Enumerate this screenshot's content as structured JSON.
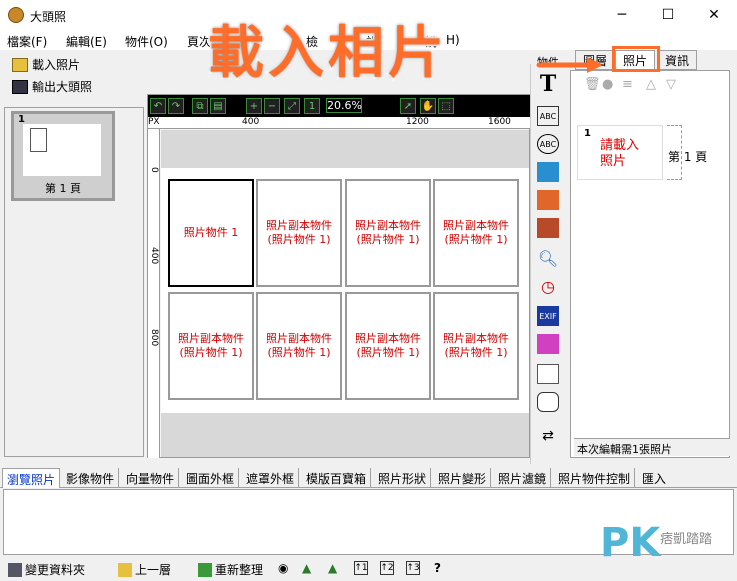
{
  "window": {
    "title": "大頭照",
    "min": "─",
    "max": "☐",
    "close": "✕"
  },
  "menu": [
    "檔案(F)",
    "編輯(E)",
    "物件(O)",
    "頁次",
    "檢",
    "設",
    "說",
    "H)"
  ],
  "left_toolbar": {
    "load_photo": "載入照片",
    "export": "輸出大頭照"
  },
  "thumbnail": {
    "num": "1",
    "label": "第 1 頁"
  },
  "editor_toolbar": {
    "zoom": "20.6%"
  },
  "ruler": {
    "h": [
      "PX",
      "400",
      "1200",
      "1600"
    ],
    "v": [
      "0",
      "400",
      "800"
    ]
  },
  "cells": [
    "照片物件 1",
    "照片副本物件\n(照片物件 1)",
    "照片副本物件\n(照片物件 1)",
    "照片副本物件\n(照片物件 1)",
    "照片副本物件\n(照片物件 1)",
    "照片副本物件\n(照片物件 1)",
    "照片副本物件\n(照片物件 1)",
    "照片副本物件\n(照片物件 1)"
  ],
  "tool_column": {
    "tab": "物件",
    "items": [
      "T",
      "ABC",
      "ABC",
      "",
      "",
      "",
      "",
      "",
      "EXIF",
      "",
      "",
      "",
      ""
    ]
  },
  "right_panel": {
    "tabs": [
      "圖層",
      "照片",
      "資訊"
    ],
    "card_num": "1",
    "card_text": "請載入\n照片",
    "page_label": "第 1 頁",
    "status": "本次編輯需1張照片"
  },
  "bottom_tabs": [
    "瀏覽照片",
    "影像物件",
    "向量物件",
    "圖面外框",
    "遮罩外框",
    "模版百寶箱",
    "照片形狀",
    "照片變形",
    "照片濾鏡",
    "照片物件控制",
    "匯入"
  ],
  "status_bar": {
    "change_folder": "變更資料夾",
    "up": "上一層",
    "refresh": "重新整理",
    "help": "?"
  },
  "overlay": {
    "title": "載入相片"
  },
  "watermark": {
    "logo": "PK",
    "sub": "痞凱踏踏"
  },
  "colors": {
    "accent": "#ff6d2a",
    "cell_text": "#d00000"
  }
}
